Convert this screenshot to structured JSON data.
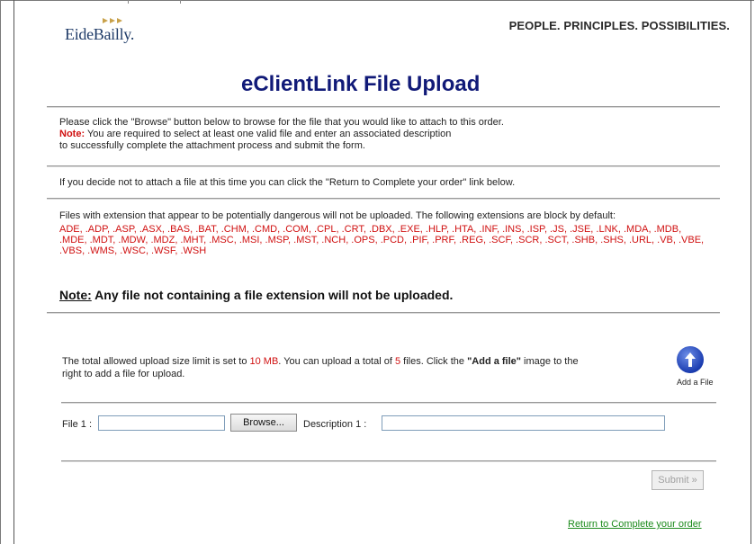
{
  "header": {
    "logo_text": "EideBailly.",
    "tagline": "PEOPLE. PRINCIPLES. POSSIBILITIES."
  },
  "page_title": "eClientLink File Upload",
  "intro": {
    "line1": "Please click the \"Browse\" button below to browse for the file that you would like to attach to this order.",
    "note_label": "Note:",
    "note_text": " You are required to select at least one valid file and enter an associated description",
    "line3": "to successfully complete the attachment process and submit the form."
  },
  "return_hint": "If you decide not to attach a file at this time you can click the \"Return to Complete your order\" link below.",
  "dangerous": {
    "text": "Files with extension that appear to be potentially dangerous will not be uploaded. The following extensions are block by default:",
    "extensions": "ADE, .ADP, .ASP, .ASX, .BAS, .BAT, .CHM, .CMD, .COM, .CPL, .CRT, .DBX, .EXE, .HLP, .HTA, .INF, .INS, .ISP, .JS, .JSE, .LNK, .MDA, .MDB, .MDE, .MDT, .MDW, .MDZ, .MHT, .MSC, .MSI, .MSP, .MST, .NCH, .OPS, .PCD, .PIF, .PRF, .REG, .SCF, .SCR, .SCT, .SHB, .SHS, .URL, .VB, .VBE, .VBS, .WMS, .WSC, .WSF, .WSH"
  },
  "note2": {
    "label": "Note:",
    "text": " Any file not containing a file extension will not be uploaded."
  },
  "limits": {
    "part1": "The total allowed upload size limit is set to ",
    "size": "10 MB",
    "part2": ". You can upload a total of ",
    "count": "5",
    "part3": " files. Click the ",
    "image_name": "\"Add a file\"",
    "part4": " image to the",
    "line2": "right to add a file for upload."
  },
  "add_file": {
    "icon": "up-arrow-circle-icon",
    "label": "Add a File"
  },
  "form": {
    "file_label": "File 1 :",
    "file_value": "",
    "browse_label": "Browse...",
    "desc_label": "Description 1 :",
    "desc_value": "",
    "submit_label": "Submit »"
  },
  "return_link": "Return to Complete your order",
  "colors": {
    "title": "#111a78",
    "warning": "#d01010",
    "link": "#1b8a1b"
  }
}
